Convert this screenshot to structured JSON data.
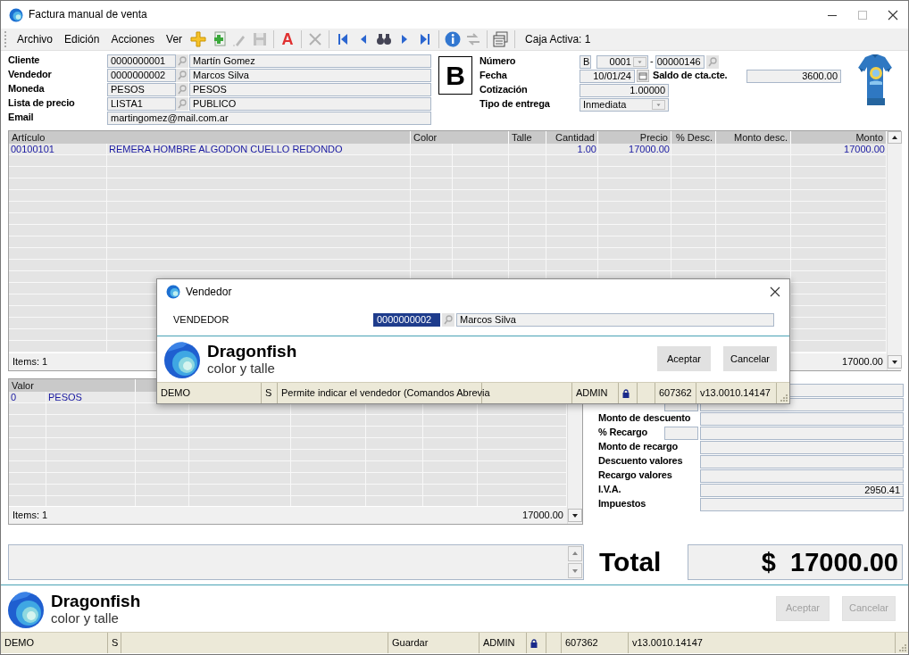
{
  "window": {
    "title": "Factura manual de venta"
  },
  "menu": [
    {
      "label": "Archivo"
    },
    {
      "label": "Edición"
    },
    {
      "label": "Acciones"
    },
    {
      "label": "Ver"
    }
  ],
  "toolbar": [
    {
      "kind": "add",
      "disabled": false
    },
    {
      "kind": "copy",
      "disabled": false
    },
    {
      "kind": "edit",
      "disabled": true
    },
    {
      "kind": "save",
      "disabled": true
    },
    {
      "kind": "sep"
    },
    {
      "kind": "format",
      "glyph": "A",
      "disabled": false
    },
    {
      "kind": "sep"
    },
    {
      "kind": "delete",
      "disabled": true
    },
    {
      "kind": "sep"
    },
    {
      "kind": "first",
      "disabled": false
    },
    {
      "kind": "prev",
      "disabled": false
    },
    {
      "kind": "find",
      "disabled": false
    },
    {
      "kind": "next",
      "disabled": false
    },
    {
      "kind": "last",
      "disabled": false
    },
    {
      "kind": "sep"
    },
    {
      "kind": "info",
      "disabled": false
    },
    {
      "kind": "swap",
      "disabled": true
    },
    {
      "kind": "sep"
    },
    {
      "kind": "windows",
      "disabled": false
    },
    {
      "kind": "sep"
    }
  ],
  "caja": "Caja Activa: 1",
  "header": {
    "fields": [
      {
        "label": "Cliente",
        "code": "0000000001",
        "description": "Martín Gomez"
      },
      {
        "label": "Vendedor",
        "code": "0000000002",
        "description": "Marcos Silva"
      },
      {
        "label": "Moneda",
        "code": "PESOS",
        "description": "PESOS"
      },
      {
        "label": "Lista de precio",
        "code": "LISTA1",
        "description": "PUBLICO"
      }
    ],
    "email": {
      "label": "Email",
      "value": "martingomez@mail.com.ar"
    },
    "letter": "B",
    "numero": {
      "label": "Número",
      "letra": "B",
      "punto": "0001",
      "separator": "-",
      "numero": "00000146"
    },
    "fecha": {
      "label": "Fecha",
      "value": "10/01/24"
    },
    "saldo": {
      "label": "Saldo de cta.cte.",
      "value": "3600.00"
    },
    "cotizacion": {
      "label": "Cotización",
      "value": "1.00000"
    },
    "tipo_entrega": {
      "label": "Tipo de entrega",
      "value": "Inmediata"
    }
  },
  "items_grid": {
    "columns": [
      "Artículo",
      "Color",
      "Talle",
      "Cantidad",
      "Precio",
      "% Desc.",
      "Monto desc.",
      "Monto"
    ],
    "rows": [
      {
        "articulo": "00100101",
        "descripcion": "REMERA HOMBRE ALGODON CUELLO REDONDO",
        "cantidad": "1.00",
        "precio": "17000.00",
        "monto": "17000.00"
      }
    ],
    "footer_count": "Items: 1",
    "footer_total": "17000.00"
  },
  "values_grid": {
    "columns": [
      "Valor"
    ],
    "rows": [
      {
        "valor": "0",
        "nombre": "PESOS"
      }
    ],
    "footer_count": "Items: 1",
    "footer_total": "17000.00"
  },
  "totals": [
    {
      "kind": "plain"
    },
    {
      "kind": "percent"
    },
    {
      "kind": "plain",
      "label": "Monto de descuento"
    },
    {
      "kind": "percent",
      "label": "% Recargo"
    },
    {
      "kind": "plain",
      "label": "Monto de recargo"
    },
    {
      "kind": "plain",
      "label": "Descuento valores"
    },
    {
      "kind": "plain",
      "label": "Recargo valores"
    },
    {
      "kind": "plain",
      "label": "I.V.A.",
      "value": "2950.41"
    },
    {
      "kind": "plain",
      "label": "Impuestos"
    }
  ],
  "total": {
    "label": "Total",
    "value": "$  17000.00"
  },
  "brand": {
    "name": "Dragonfish",
    "tagline": "color y talle"
  },
  "buttons": [
    {
      "label": "Aceptar",
      "disabled": true
    },
    {
      "label": "Cancelar",
      "disabled": true
    }
  ],
  "status_bar": [
    {
      "kind": "text",
      "text": "DEMO"
    },
    {
      "kind": "text",
      "text": "S"
    },
    {
      "kind": "spacer"
    },
    {
      "kind": "text",
      "text": "Guardar"
    },
    {
      "kind": "text",
      "text": "ADMIN"
    },
    {
      "kind": "lock"
    },
    {
      "kind": "spacer"
    },
    {
      "kind": "text",
      "text": "607362"
    },
    {
      "kind": "text",
      "text": "v13.0010.14147"
    }
  ],
  "dialog": {
    "title": "Vendedor",
    "field": {
      "label": "VENDEDOR",
      "code": "0000000002",
      "code_selected": true,
      "description": "Marcos Silva"
    },
    "brand": {
      "name": "Dragonfish",
      "tagline": "color y talle"
    },
    "buttons": [
      {
        "label": "Aceptar",
        "disabled": false
      },
      {
        "label": "Cancelar",
        "disabled": false
      }
    ],
    "status_bar": [
      {
        "kind": "text",
        "text": "DEMO"
      },
      {
        "kind": "text",
        "text": "S"
      },
      {
        "kind": "text",
        "text": "Permite indicar el vendedor (Comandos Abrevia"
      },
      {
        "kind": "spacer"
      },
      {
        "kind": "text",
        "text": "ADMIN"
      },
      {
        "kind": "lock"
      },
      {
        "kind": "spacer"
      },
      {
        "kind": "text",
        "text": "607362"
      },
      {
        "kind": "text",
        "text": "v13.0010.14147"
      }
    ]
  }
}
